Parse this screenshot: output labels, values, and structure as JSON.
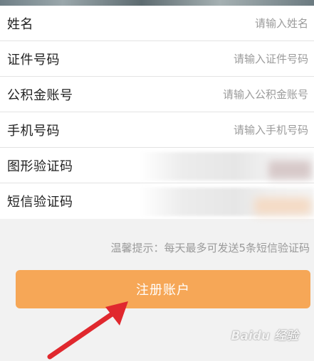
{
  "form": {
    "rows": [
      {
        "label": "姓名",
        "placeholder": "请输入姓名"
      },
      {
        "label": "证件号码",
        "placeholder": "请输入证件号码"
      },
      {
        "label": "公积金账号",
        "placeholder": "请输入公积金账号"
      },
      {
        "label": "手机号码",
        "placeholder": "请输入手机号码"
      },
      {
        "label": "图形验证码"
      },
      {
        "label": "短信验证码"
      }
    ]
  },
  "tip": "温馨提示：每天最多可发送5条短信验证码",
  "register_label": "注册账户",
  "colors": {
    "button": "#f6a757",
    "arrow": "#e0282e",
    "background": "#f2f2f2"
  },
  "watermark": "Baidu 经验"
}
